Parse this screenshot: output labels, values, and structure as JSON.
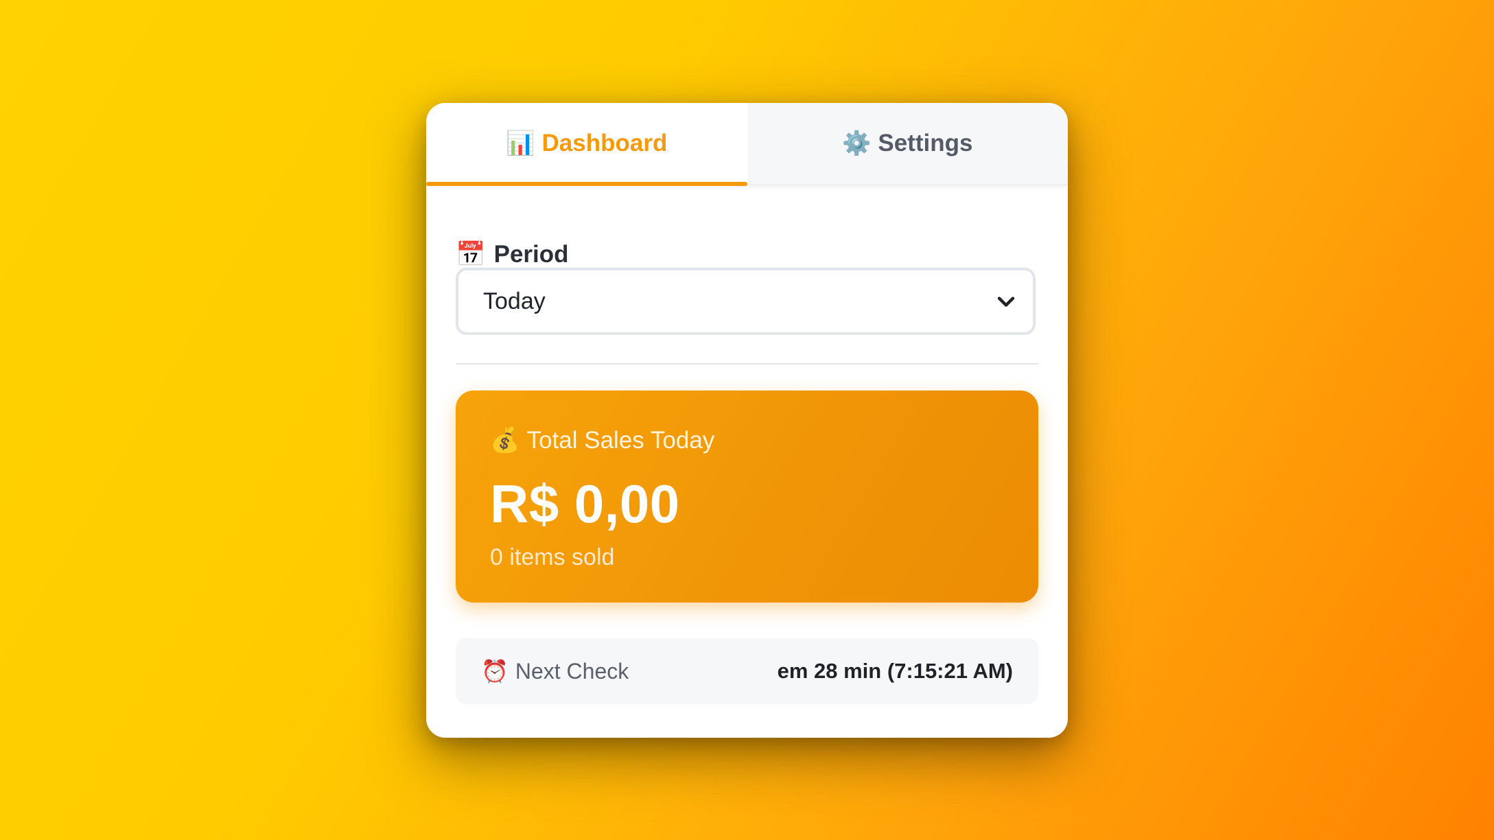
{
  "tabs": [
    {
      "label": "Dashboard",
      "icon": "📊",
      "icon_name": "bar-chart-icon",
      "active": true
    },
    {
      "label": "Settings",
      "icon": "⚙️",
      "icon_name": "gear-icon",
      "active": false
    }
  ],
  "period": {
    "label": "Period",
    "icon": "📅",
    "icon_name": "calendar-icon",
    "selected": "Today"
  },
  "sales": {
    "icon": "💰",
    "icon_name": "money-bag-icon",
    "title": "Total Sales Today",
    "amount": "R$ 0,00",
    "items": "0 items sold"
  },
  "next_check": {
    "icon": "⏰",
    "icon_name": "alarm-clock-icon",
    "label": "Next Check",
    "value": "em 28 min (7:15:21 AM)"
  },
  "colors": {
    "accent": "#f59a0b",
    "card_gradient_start": "#f7a30a",
    "card_gradient_end": "#ec8c04",
    "background_start": "#ffd200",
    "background_end": "#ff8200"
  }
}
